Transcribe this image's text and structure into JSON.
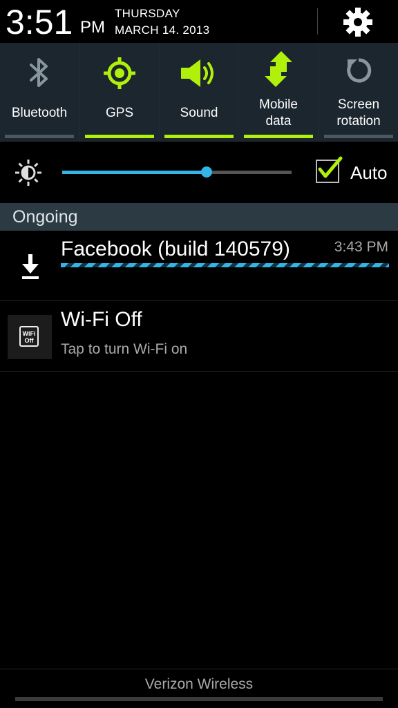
{
  "header": {
    "time": "3:51",
    "ampm": "PM",
    "day": "THURSDAY",
    "date": "MARCH 14. 2013",
    "settings_icon": "gear-icon"
  },
  "toggles": [
    {
      "label": "Bluetooth",
      "icon": "bluetooth-icon",
      "on": false
    },
    {
      "label": "GPS",
      "icon": "gps-icon",
      "on": true
    },
    {
      "label": "Sound",
      "icon": "sound-icon",
      "on": true
    },
    {
      "label_line1": "Mobile",
      "label_line2": "data",
      "icon": "mobile-data-icon",
      "on": true
    },
    {
      "label_line1": "Screen",
      "label_line2": "rotation",
      "icon": "rotation-icon",
      "on": false
    }
  ],
  "brightness": {
    "level_percent": 63,
    "auto_checked": true,
    "auto_label": "Auto"
  },
  "ongoing": {
    "title": "Ongoing"
  },
  "notifications": [
    {
      "title": "Facebook (build 140579)",
      "time": "3:43 PM",
      "icon": "download-icon",
      "progress": "indeterminate"
    },
    {
      "title": "Wi-Fi Off",
      "subtitle": "Tap to turn Wi-Fi on",
      "icon": "wifi-off-icon",
      "badge_line1": "WiFi",
      "badge_line2": "Off"
    }
  ],
  "footer": {
    "carrier": "Verizon Wireless"
  },
  "colors": {
    "accent_green": "#b0f00a",
    "accent_blue": "#33b5e5",
    "toggle_bg": "#1b262e",
    "section_bg": "#2c3a44"
  }
}
